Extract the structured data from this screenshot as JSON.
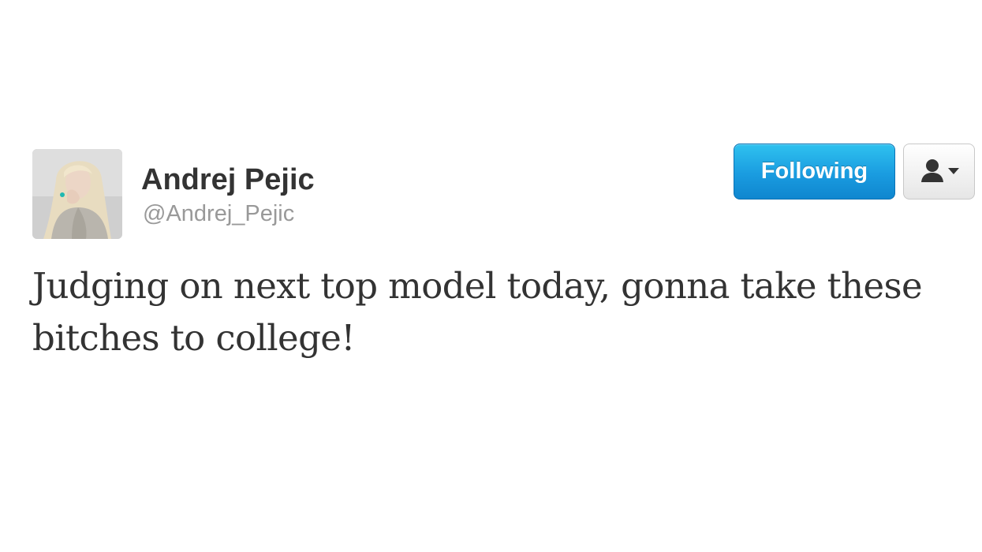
{
  "user": {
    "name": "Andrej Pejic",
    "handle": "@Andrej_Pejic",
    "avatar_icon": "profile-photo"
  },
  "actions": {
    "follow_label": "Following",
    "user_menu_icon": "person-dropdown-icon"
  },
  "tweet": {
    "text": "Judging on next top model today, gonna take these bitches to college!"
  },
  "colors": {
    "following_button": "#1a9ce0",
    "text": "#333333",
    "handle": "#999999"
  }
}
